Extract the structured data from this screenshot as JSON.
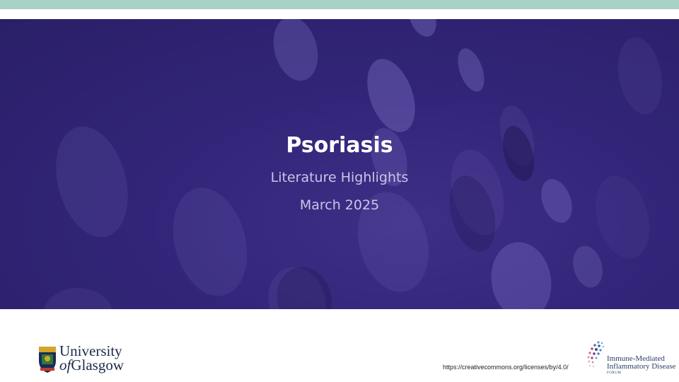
{
  "slide": {
    "title": "Psoriasis",
    "subtitle": "Literature Highlights",
    "date": "March 2025"
  },
  "footer": {
    "university_logo": {
      "line1": "University",
      "line2_prefix": "of",
      "line2_rest": "Glasgow"
    },
    "license_url": "https://creativecommons.org/licenses/by/4.0/",
    "forum_logo": {
      "line1": "Immune-Mediated",
      "line2": "Inflammatory Disease",
      "line3": "FORUM"
    }
  },
  "colors": {
    "top_strip": "#a8d0c4",
    "hero_background": "#322579",
    "title": "#ffffff",
    "subtitle": "#c9c6e8"
  }
}
